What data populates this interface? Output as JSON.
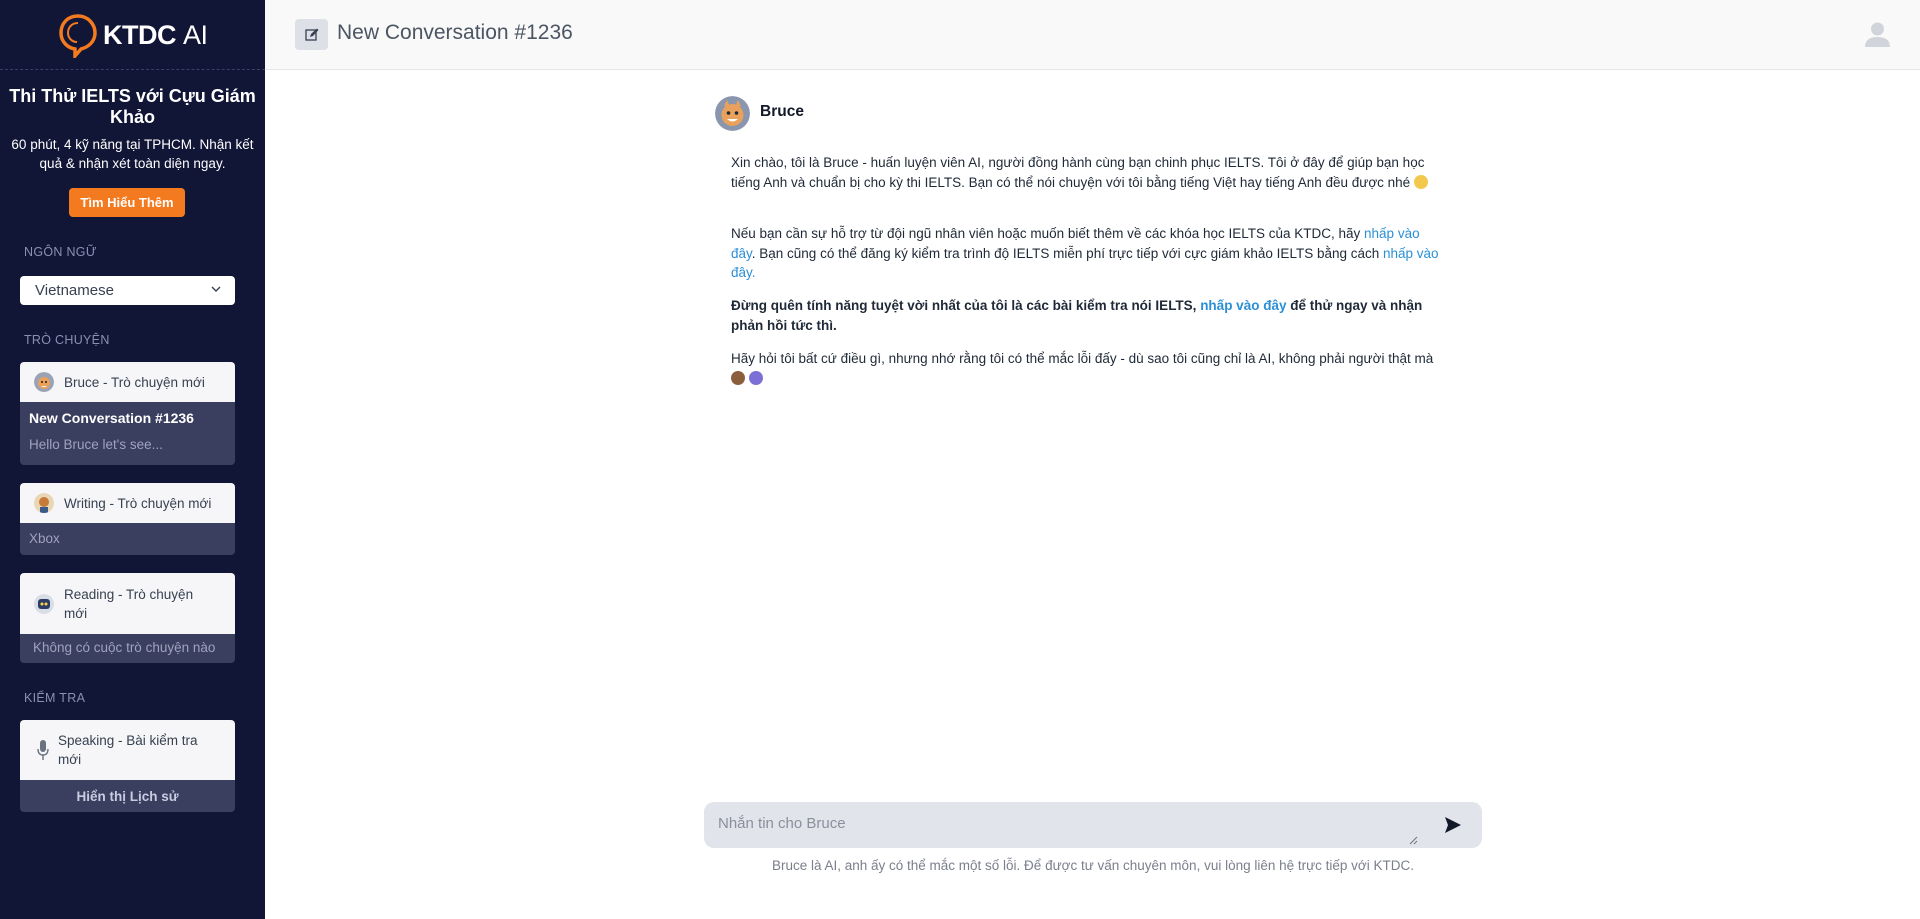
{
  "sidebar": {
    "logo": {
      "brand": "KTDC",
      "suffix": "AI"
    },
    "promo": {
      "title": "Thi Thử IELTS với Cựu Giám Khảo",
      "description": "60 phút, 4 kỹ năng tại TPHCM. Nhận kết quả & nhận xét toàn diện ngay.",
      "button": "Tìm Hiểu Thêm"
    },
    "language_label": "NGÔN NGỮ",
    "language_value": "Vietnamese",
    "chat_label": "TRÒ CHUYỆN",
    "chat_cards": [
      {
        "title": "Bruce - Trò chuyện mới",
        "conversation": "New Conversation #1236",
        "preview": "Hello Bruce let's see..."
      },
      {
        "title": "Writing - Trò chuyện mới",
        "item": "Xbox"
      },
      {
        "title": "Reading - Trò chuyện mới",
        "empty": "Không có cuộc trò chuyện nào"
      }
    ],
    "test_label": "KIỂM TRA",
    "test_card": {
      "title": "Speaking - Bài kiểm tra mới",
      "history_button": "Hiển thị Lịch sử"
    }
  },
  "header": {
    "title": "New Conversation #1236"
  },
  "message": {
    "sender": "Bruce",
    "p1": "Xin chào, tôi là Bruce - huấn luyện viên AI, người đồng hành cùng bạn chinh phục IELTS. Tôi ở đây để giúp bạn học tiếng Anh và chuẩn bị cho kỳ thi IELTS. Bạn có thể nói chuyện với tôi bằng tiếng Việt hay tiếng Anh đều được nhé",
    "p2_a": "Nếu bạn cần sự hỗ trợ từ đội ngũ nhân viên hoặc muốn biết thêm về các khóa học IELTS của KTDC, hãy ",
    "p2_link1": "nhấp vào đây",
    "p2_b": ". Bạn cũng có thể đăng ký kiểm tra trình độ IELTS miễn phí trực tiếp với cực giám khảo IELTS bằng cách ",
    "p2_link2": "nhấp vào đây.",
    "p3_a": "Đừng quên tính năng tuyệt vời nhất của tôi là các bài kiểm tra nói IELTS, ",
    "p3_link": "nhấp vào đây",
    "p3_b": " để thử ngay và nhận phản hồi tức thì.",
    "p4": "Hãy hỏi tôi bất cứ điều gì, nhưng nhớ rằng tôi có thể mắc lỗi đấy - dù sao tôi cũng chỉ là AI, không phải người thật mà"
  },
  "composer": {
    "placeholder": "Nhắn tin cho Bruce",
    "disclaimer": "Bruce là AI, anh ấy có thể mắc một số lỗi. Để được tư vấn chuyên môn, vui lòng liên hệ trực tiếp với KTDC."
  },
  "colors": {
    "sidebar_bg": "#111536",
    "accent_orange": "#f47a20",
    "link_blue": "#2b8fd6",
    "card_body": "#3a3e5f"
  }
}
